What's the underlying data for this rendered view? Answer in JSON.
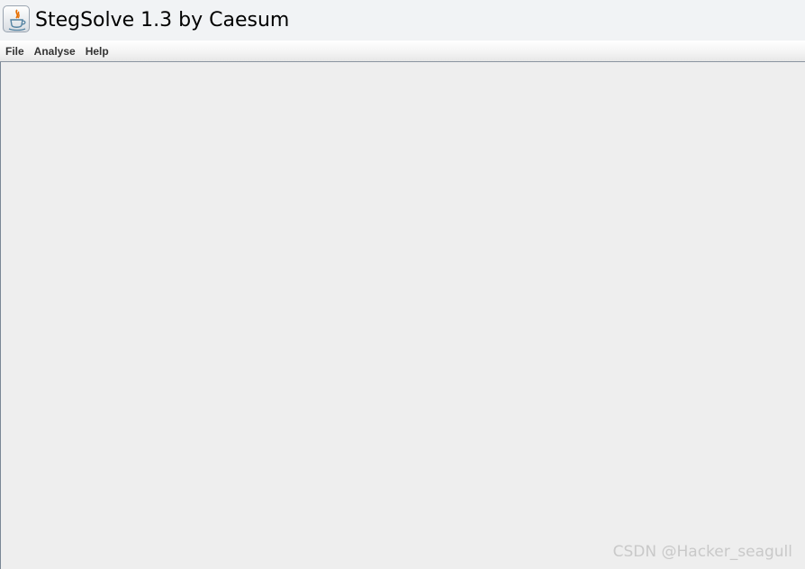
{
  "window": {
    "title": "StegSolve 1.3 by Caesum",
    "icon": "java-coffee-cup-icon"
  },
  "menubar": {
    "items": [
      {
        "label": "File"
      },
      {
        "label": "Analyse"
      },
      {
        "label": "Help"
      }
    ]
  },
  "watermark": {
    "text": "CSDN @Hacker_seagull"
  },
  "colors": {
    "titlebar_bg": "#f1f3f5",
    "content_bg": "#eeeeee",
    "border": "#7a8796",
    "java_orange": "#e76f00",
    "java_blue": "#5382a1"
  }
}
